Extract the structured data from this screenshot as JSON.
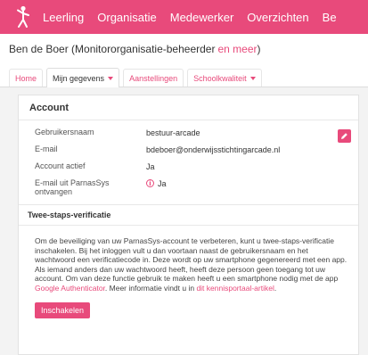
{
  "nav": {
    "items": [
      {
        "label": "Leerling"
      },
      {
        "label": "Organisatie"
      },
      {
        "label": "Medewerker"
      },
      {
        "label": "Overzichten"
      },
      {
        "label": "Be"
      }
    ]
  },
  "titlebar": {
    "title": "Ben de Boer (Monitororganisatie-beheerder",
    "more": "en meer",
    "close": ")"
  },
  "tabs": [
    {
      "label": "Home"
    },
    {
      "label": "Mijn gegevens"
    },
    {
      "label": "Aanstellingen"
    },
    {
      "label": "Schoolkwaliteit"
    }
  ],
  "account": {
    "heading": "Account",
    "rows": [
      {
        "label": "Gebruikersnaam",
        "value": "bestuur-arcade"
      },
      {
        "label": "E-mail",
        "value": "bdeboer@onderwijsstichtingarcade.nl"
      },
      {
        "label": "Account actief",
        "value": "Ja"
      },
      {
        "label": "E-mail uit ParnasSys ontvangen",
        "value": "Ja"
      }
    ]
  },
  "tsv": {
    "heading": "Twee-staps-verificatie",
    "text": "Om de beveiliging van uw ParnasSys-account te verbeteren, kunt u twee-staps-verificatie inschakelen. Bij het inloggen vult u dan voortaan naast de gebruikersnaam en het wachtwoord een verificatiecode in. Deze wordt op uw smartphone gegenereerd met een app. Als iemand anders dan uw wachtwoord heeft, heeft deze persoon geen toegang tot uw account. Om van deze functie gebruik te maken heeft u een smartphone nodig met de app ",
    "link1": "Google Authenticator",
    "text2": ". Meer informatie vindt u in ",
    "link2": "dit kennisportaal-artikel",
    "text3": ".",
    "button": "Inschakelen"
  },
  "colors": {
    "accent": "#e84a7b"
  },
  "icons": {
    "logo": "figure-logo",
    "edit": "pencil-icon",
    "info": "info-icon",
    "caret": "caret-down-icon"
  }
}
